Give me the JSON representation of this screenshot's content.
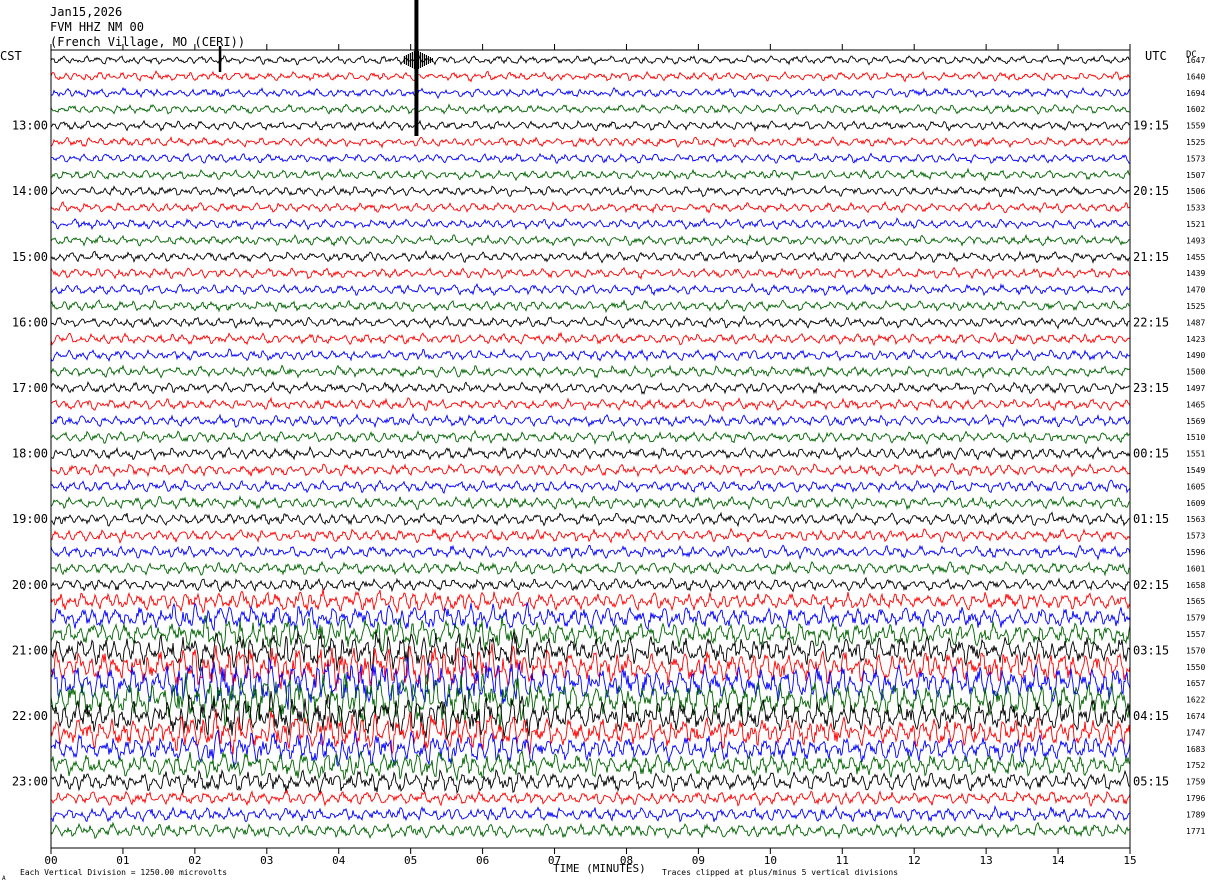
{
  "header": {
    "date": "Jan15,2026",
    "station": "FVM HHZ NM 00",
    "location": "(French Village, MO (CERI))"
  },
  "left_tz": "CST",
  "right_tz": "UTC",
  "dc_label": "DC",
  "footer": {
    "scale_note": "Each Vertical Division = 1250.00 microvolts",
    "axis_title": "TIME (MINUTES)",
    "clip_note": "Traces clipped at plus/minus 5 vertical divisions",
    "corner_mark": "A"
  },
  "colors": {
    "black": "#000000",
    "red": "#ff0000",
    "blue": "#0000ff",
    "green": "#006400"
  },
  "chart_data": {
    "type": "line",
    "xlabel": "TIME (MINUTES)",
    "xlim": [
      0,
      15
    ],
    "x_ticks": [
      "00",
      "01",
      "02",
      "03",
      "04",
      "05",
      "06",
      "07",
      "08",
      "09",
      "10",
      "11",
      "12",
      "13",
      "14",
      "15"
    ],
    "trace_minutes": 15,
    "color_cycle": [
      "black",
      "red",
      "blue",
      "green"
    ],
    "left_time_labels": [
      "13:00",
      "14:00",
      "15:00",
      "16:00",
      "17:00",
      "18:00",
      "19:00",
      "20:00",
      "21:00",
      "22:00",
      "23:00"
    ],
    "right_time_labels": [
      "19:15",
      "20:15",
      "21:15",
      "22:15",
      "23:15",
      "00:15",
      "01:15",
      "02:15",
      "03:15",
      "04:15",
      "05:15"
    ],
    "dc_offsets": [
      1647,
      1640,
      1694,
      1602,
      1559,
      1525,
      1573,
      1507,
      1506,
      1533,
      1521,
      1493,
      1455,
      1439,
      1470,
      1525,
      1487,
      1423,
      1490,
      1500,
      1497,
      1465,
      1569,
      1510,
      1551,
      1549,
      1605,
      1609,
      1563,
      1573,
      1596,
      1601,
      1658,
      1565,
      1579,
      1557,
      1570,
      1550,
      1657,
      1622,
      1674,
      1747,
      1683,
      1752,
      1759,
      1796,
      1789,
      1771
    ],
    "events": [
      {
        "trace": 0,
        "minute": 5.08,
        "label": ""
      },
      {
        "trace": 0,
        "minute": 2.35,
        "label": ""
      }
    ]
  }
}
